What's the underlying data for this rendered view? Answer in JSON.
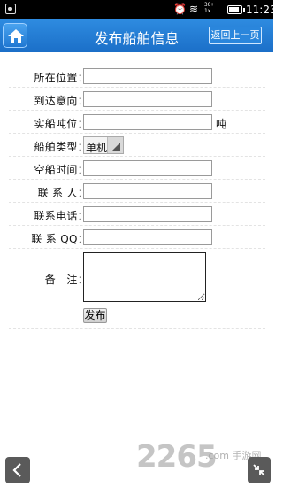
{
  "status_bar": {
    "time": "11:23",
    "network_top": "3G+",
    "network_bottom": "1x",
    "battery_level": 0.9
  },
  "header": {
    "title": "发布船舶信息",
    "back_label": "返回上一页",
    "home_icon": "home-icon"
  },
  "form": {
    "fields": [
      {
        "label": "所在位置：",
        "value": ""
      },
      {
        "label": "到达意向：",
        "value": ""
      },
      {
        "label": "实船吨位：",
        "value": "",
        "unit": "吨"
      },
      {
        "label": "船舶类型：",
        "value": "单机"
      },
      {
        "label": "空船时间：",
        "value": ""
      },
      {
        "label": "联 系 人：",
        "value": ""
      },
      {
        "label": "联系电话：",
        "value": ""
      },
      {
        "label": "联 系 QQ：",
        "value": ""
      },
      {
        "label": "备　注：",
        "value": ""
      }
    ],
    "submit_label": "发布"
  },
  "overlay": {
    "watermark": "2265",
    "watermark_sub": ".com 手游网",
    "back_icon": "chevron-left-icon",
    "expand_icon": "collapse-icon"
  },
  "colors": {
    "header": "#1b6fc8",
    "header_light": "#2e8be0",
    "status_bar": "#000000"
  }
}
